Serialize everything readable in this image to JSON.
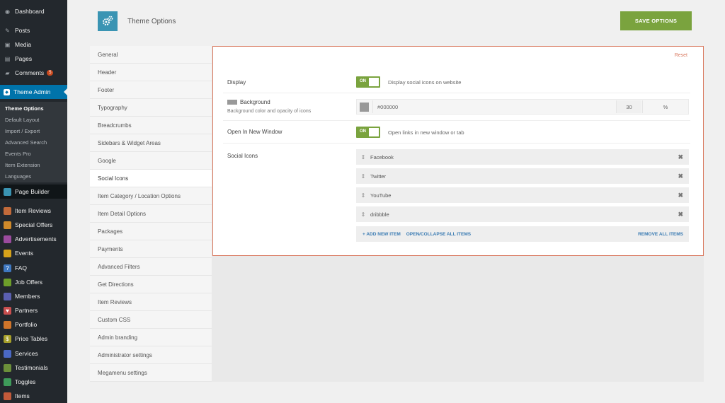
{
  "admin_menu": {
    "top": [
      {
        "label": "Dashboard",
        "icon": "dashboard-icon"
      },
      {
        "label": "Posts",
        "icon": "pin-icon"
      },
      {
        "label": "Media",
        "icon": "media-icon"
      },
      {
        "label": "Pages",
        "icon": "page-icon"
      },
      {
        "label": "Comments",
        "icon": "comment-icon",
        "badge": "5"
      }
    ],
    "theme_admin": "Theme Admin",
    "submenu": [
      "Theme Options",
      "Default Layout",
      "Import / Export",
      "Advanced Search",
      "Events Pro",
      "Item Extension",
      "Languages"
    ],
    "page_builder": "Page Builder",
    "items": [
      {
        "label": "Item Reviews",
        "color": "#c26a3a"
      },
      {
        "label": "Special Offers",
        "color": "#d08a2a"
      },
      {
        "label": "Advertisements",
        "color": "#9a4b9e"
      },
      {
        "label": "Events",
        "color": "#d6a21a"
      },
      {
        "label": "FAQ",
        "color": "#3f78c0"
      },
      {
        "label": "Job Offers",
        "color": "#6d9e2a"
      },
      {
        "label": "Members",
        "color": "#5a5fb0"
      },
      {
        "label": "Partners",
        "color": "#c94f4f"
      },
      {
        "label": "Portfolio",
        "color": "#d0752a"
      },
      {
        "label": "Price Tables",
        "color": "#a7a02a"
      },
      {
        "label": "Services",
        "color": "#4a68c4"
      },
      {
        "label": "Testimonials",
        "color": "#6b8f3a"
      },
      {
        "label": "Toggles",
        "color": "#3e9b5a"
      },
      {
        "label": "Items",
        "color": "#c25a3a"
      }
    ]
  },
  "header": {
    "title": "Theme Options",
    "save_label": "SAVE OPTIONS",
    "logo_icon": "gears-icon"
  },
  "tabs": [
    "General",
    "Header",
    "Footer",
    "Typography",
    "Breadcrumbs",
    "Sidebars & Widget Areas",
    "Google",
    "Social Icons",
    "Item Category / Location Options",
    "Item Detail Options",
    "Packages",
    "Payments",
    "Advanced Filters",
    "Get Directions",
    "Item Reviews",
    "Custom CSS",
    "Admin branding",
    "Administrator settings",
    "Megamenu settings"
  ],
  "active_tab": "Social Icons",
  "content": {
    "reset": "Reset",
    "display": {
      "label": "Display",
      "toggle": "ON",
      "desc": "Display social icons on website"
    },
    "background": {
      "label": "Background",
      "desc": "Background color and opacity of icons",
      "color": "#000000",
      "opacity": "30",
      "unit": "%"
    },
    "new_window": {
      "label": "Open In New Window",
      "toggle": "ON",
      "desc": "Open links in new window or tab"
    },
    "social_icons": {
      "label": "Social Icons",
      "items": [
        "Facebook",
        "Twitter",
        "YouTube",
        "dribbble"
      ],
      "add": "+ ADD NEW ITEM",
      "toggle_all": "OPEN/COLLAPSE ALL ITEMS",
      "remove_all": "REMOVE ALL ITEMS"
    }
  },
  "colors": {
    "admin_bg": "#23282d",
    "accent_blue": "#0073aa",
    "save_green": "#7aa33e",
    "card_border": "#d9795f"
  }
}
